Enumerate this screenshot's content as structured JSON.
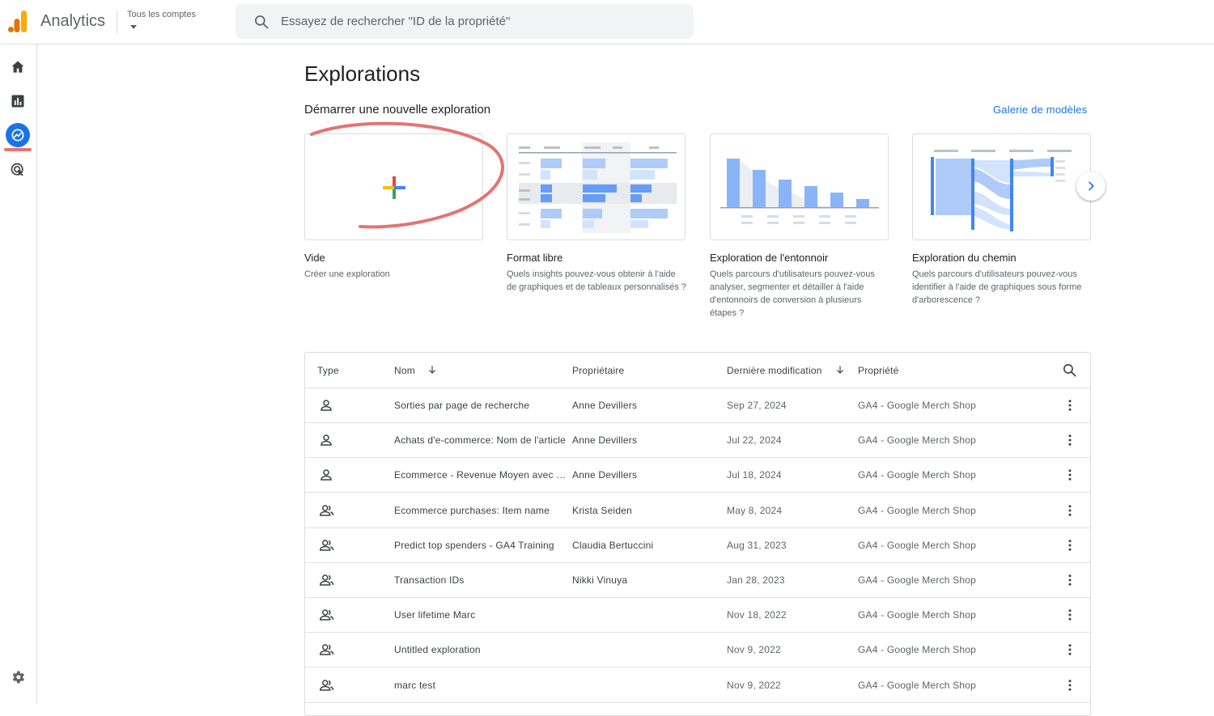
{
  "header": {
    "app_name": "Analytics",
    "account_label": "Tous les comptes",
    "search_placeholder": "Essayez de rechercher \"ID de la propriété\""
  },
  "nav": {
    "items": [
      "home-icon",
      "reports-icon",
      "explore-icon",
      "advertising-icon"
    ],
    "active": "explore-icon",
    "bottom": "settings-icon"
  },
  "main": {
    "title": "Explorations",
    "subtitle": "Démarrer une nouvelle exploration",
    "gallery_link": "Galerie de modèles",
    "templates": [
      {
        "title": "Vide",
        "description": "Créer une exploration"
      },
      {
        "title": "Format libre",
        "description": "Quels insights pouvez-vous obtenir à l'aide de graphiques et de tableaux personnalisés ?"
      },
      {
        "title": "Exploration de l'entonnoir",
        "description": "Quels parcours d'utilisateurs pouvez-vous analyser, segmenter et détailler à l'aide d'entonnoirs de conversion à plusieurs étapes ?"
      },
      {
        "title": "Exploration du chemin",
        "description": "Quels parcours d'utilisateurs pouvez-vous identifier à l'aide de graphiques sous forme d'arborescence ?"
      }
    ]
  },
  "table": {
    "columns": [
      "Type",
      "Nom",
      "Propriétaire",
      "Dernière modification",
      "Propriété"
    ],
    "rows": [
      {
        "type": "user",
        "name": "Sorties par page de recherche",
        "owner": "Anne Devillers",
        "modified": "Sep 27, 2024",
        "property": "GA4 - Google Merch Shop"
      },
      {
        "type": "user",
        "name": "Achats d'e-commerce: Nom de l'article",
        "owner": "Anne Devillers",
        "modified": "Jul 22, 2024",
        "property": "GA4 - Google Merch Shop"
      },
      {
        "type": "user",
        "name": "Ecommerce - Revenue Moyen avec / s...",
        "owner": "Anne Devillers",
        "modified": "Jul 18, 2024",
        "property": "GA4 - Google Merch Shop"
      },
      {
        "type": "shared",
        "name": "Ecommerce purchases: Item name",
        "owner": "Krista Seiden",
        "modified": "May 8, 2024",
        "property": "GA4 - Google Merch Shop"
      },
      {
        "type": "shared",
        "name": "Predict top spenders - GA4 Training",
        "owner": "Claudia Bertuccini",
        "modified": "Aug 31, 2023",
        "property": "GA4 - Google Merch Shop"
      },
      {
        "type": "shared",
        "name": "Transaction IDs",
        "owner": "Nikki Vinuya",
        "modified": "Jan 28, 2023",
        "property": "GA4 - Google Merch Shop"
      },
      {
        "type": "shared",
        "name": "User lifetime Marc",
        "owner": "",
        "modified": "Nov 18, 2022",
        "property": "GA4 - Google Merch Shop"
      },
      {
        "type": "shared",
        "name": "Untitled exploration",
        "owner": "",
        "modified": "Nov 9, 2022",
        "property": "GA4 - Google Merch Shop"
      },
      {
        "type": "shared",
        "name": "marc test",
        "owner": "",
        "modified": "Nov 9, 2022",
        "property": "GA4 - Google Merch Shop"
      }
    ]
  },
  "colors": {
    "accent": "#1a73e8",
    "annotation": "#e57373",
    "logo": [
      "#f9ab00",
      "#e37400"
    ]
  }
}
